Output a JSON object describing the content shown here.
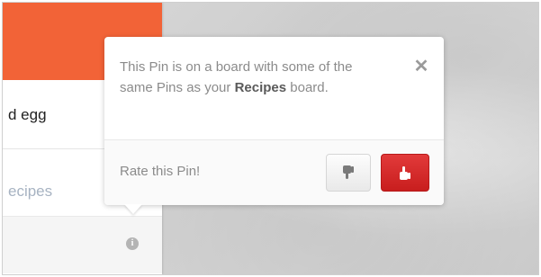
{
  "pin_card": {
    "description_fragment": "d egg",
    "board_fragment": "ecipes",
    "image_color": "#f26337",
    "info_icon": "info-icon"
  },
  "popover": {
    "message_pre": "This Pin is on a board with some of the same Pins as your ",
    "message_board": "Recipes",
    "message_post": " board.",
    "close_icon": "close-icon",
    "rate_label": "Rate this Pin!",
    "thumbs_down_icon": "thumbs-down-icon",
    "thumbs_up_icon": "thumbs-up-icon",
    "accent_color": "#d42a2a"
  }
}
